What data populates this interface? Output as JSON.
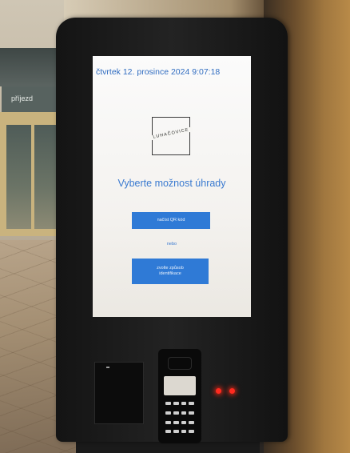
{
  "kiosk": {
    "datetime": "čtvrtek 12. prosince 2024  9:07:18",
    "logo_text": "LUHAČOVICE",
    "heading": "Vyberte možnost úhrady",
    "buttons": {
      "qr_label": "načíst QR kód",
      "other_line1": "zvolte způsob",
      "other_line2": "identifikace"
    },
    "or_text": "nebo"
  },
  "background": {
    "door_sign": "příjezd"
  },
  "colors": {
    "accent": "#2f7ad6",
    "text_blue": "#3a7ad0",
    "led": "#ff2a1f",
    "kiosk_body": "#1c1c1c"
  },
  "icons": [
    "card-slot-icon",
    "payment-terminal-icon",
    "status-led-icon"
  ]
}
